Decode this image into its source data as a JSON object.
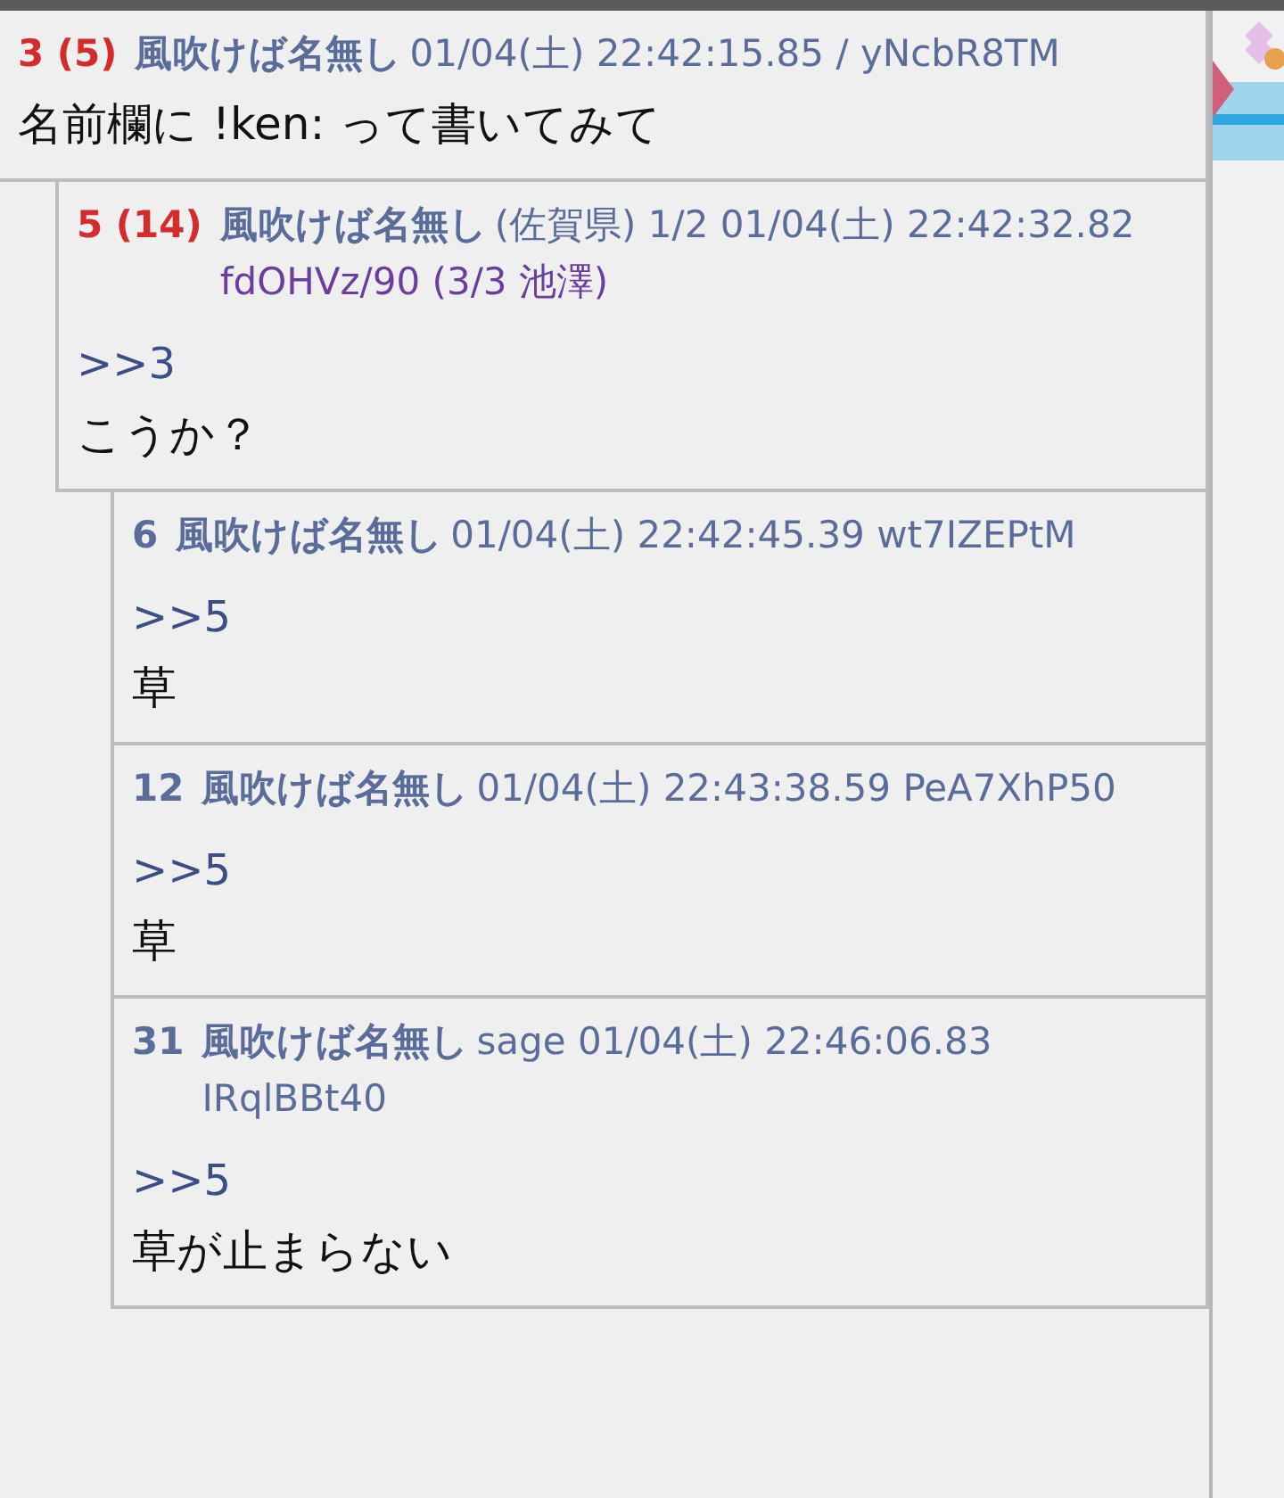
{
  "posts": [
    {
      "number": "3",
      "reply_count": "(5)",
      "name": "風吹けば名無し",
      "datetime": "01/04(土) 22:42:15.85 /",
      "id": "yNcbR8TM",
      "id_highlighted": false,
      "body": "名前欄に !ken: って書いてみて",
      "children": [
        {
          "number": "5",
          "reply_count": "(14)",
          "name": "風吹けば名無し",
          "region": "(佐賀県)",
          "count": "1/2",
          "datetime": "01/04(土) 22:42:32.82",
          "id": "fdOHVz/90",
          "id_count": "(3/3 池澤)",
          "id_highlighted": true,
          "anchor": ">>3",
          "body": "こうか？",
          "children": [
            {
              "number": "6",
              "name": "風吹けば名無し",
              "datetime": "01/04(土) 22:42:45.39",
              "id": "wt7IZEPtM",
              "id_highlighted": false,
              "anchor": ">>5",
              "body": "草"
            },
            {
              "number": "12",
              "name": "風吹けば名無し",
              "datetime": "01/04(土) 22:43:38.59",
              "id": "PeA7XhP50",
              "id_highlighted": false,
              "anchor": ">>5",
              "body": "草"
            },
            {
              "number": "31",
              "name": "風吹けば名無し",
              "mail": "sage",
              "datetime": "01/04(土) 22:46:06.83",
              "id": "IRqlBBt40",
              "id_highlighted": false,
              "anchor": ">>5",
              "body": "草が止まらない"
            }
          ]
        }
      ]
    }
  ]
}
